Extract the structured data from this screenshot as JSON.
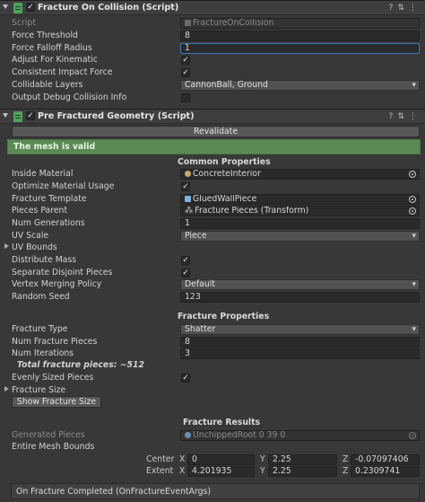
{
  "comp1": {
    "title": "Fracture On Collision (Script)",
    "rows": {
      "script_label": "Script",
      "script_value": "FractureOnCollision",
      "threshold_label": "Force Threshold",
      "threshold_value": "8",
      "falloff_label": "Force Falloff Radius",
      "falloff_value": "1",
      "kinematic_label": "Adjust For Kinematic",
      "consistent_label": "Consistent Impact Force",
      "layers_label": "Collidable Layers",
      "layers_value": "CannonBall, Ground",
      "debug_label": "Output Debug Collision Info"
    }
  },
  "comp2": {
    "title": "Pre Fractured Geometry (Script)",
    "revalidate": "Revalidate",
    "valid_msg": "The mesh is valid",
    "common_header": "Common Properties",
    "inside_material_label": "Inside Material",
    "inside_material_value": "ConcreteInterior",
    "optimize_label": "Optimize Material Usage",
    "template_label": "Fracture Template",
    "template_value": "GluedWallPiece",
    "parent_label": "Pieces Parent",
    "parent_value": "Fracture Pieces (Transform)",
    "generations_label": "Num Generations",
    "generations_value": "1",
    "uvscale_label": "UV Scale",
    "uvscale_value": "Piece",
    "uvbounds_label": "UV Bounds",
    "mass_label": "Distribute Mass",
    "disjoint_label": "Separate Disjoint Pieces",
    "merging_label": "Vertex Merging Policy",
    "merging_value": "Default",
    "seed_label": "Random Seed",
    "seed_value": "123",
    "fracture_header": "Fracture Properties",
    "type_label": "Fracture Type",
    "type_value": "Shatter",
    "pieces_label": "Num Fracture Pieces",
    "pieces_value": "8",
    "iterations_label": "Num Iterations",
    "iterations_value": "3",
    "total_text": "Total fracture pieces:  ~512",
    "evenly_label": "Evenly Sized Pieces",
    "size_label": "Fracture Size",
    "show_size_btn": "Show Fracture Size",
    "results_header": "Fracture Results",
    "generated_label": "Generated Pieces",
    "generated_value": "UnchippedRoot 0 39 0",
    "bounds_label": "Entire Mesh Bounds",
    "center_label": "Center",
    "extent_label": "Extent",
    "x_label": "X",
    "y_label": "Y",
    "z_label": "Z",
    "center_x": "0",
    "center_y": "2.25",
    "center_z": "-0.07097406",
    "extent_x": "4.201935",
    "extent_y": "2.25",
    "extent_z": "0.2309741",
    "event_label": "On Fracture Completed (OnFractureEventArgs)"
  },
  "icons": {
    "help": "question-icon",
    "presets": "sliders-icon",
    "menu": "kebab-icon",
    "check": "✓"
  },
  "colors": {
    "panel_bg": "#383838",
    "field_bg": "#2a2a2a",
    "valid_bg": "#5b8a54",
    "focus": "#3a79bb"
  }
}
